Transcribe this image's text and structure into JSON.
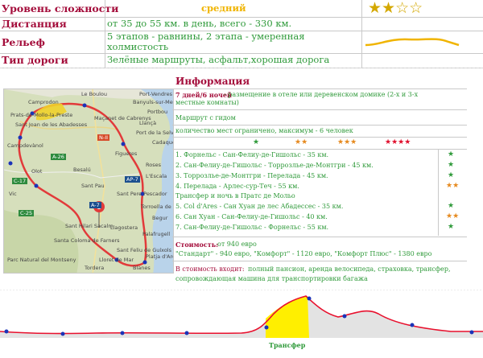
{
  "specs": {
    "difficulty": {
      "label": "Уровень сложности",
      "value": "средний",
      "stars_filled": 2,
      "stars_total": 4
    },
    "distance": {
      "label": "Дистанция",
      "value": "от 35 до 55 км. в день, всего - 330 км."
    },
    "relief": {
      "label": "Рельеф",
      "value_line1": "5 этапов - равнины, 2 этапа - умеренная",
      "value_line2": "холмистость"
    },
    "road": {
      "label": "Тип дороги",
      "value": "Зелёные маршруты, асфальт,хорошая дорога"
    }
  },
  "info": {
    "title": "Информация",
    "nights_bold": "7 дней/6 ночей",
    "nights_rest1": " - размещение в отеле или деревенском домике (2-х и 3-х",
    "nights_rest2": "местные комнаты)",
    "guide": "Маршрут с гидом",
    "limit": "количество мест ограничено, максимум - 6 человек",
    "legend_stars": [
      "★",
      "★★",
      "★★★",
      "★★★★"
    ],
    "stages": [
      {
        "text": "1. Форнельс - Сан-Фелиу-де-Гишольс - 35 км.",
        "stars": "★",
        "color": "green"
      },
      {
        "text": "2. Сан-Фелиу-де-Гишольс - Торрозлье-де-Монтгри - 45 км.",
        "stars": "★",
        "color": "green"
      },
      {
        "text": "3. Торрозлье-де-Монтгри - Перелада - 45 км.",
        "stars": "★",
        "color": "green"
      },
      {
        "text": "4. Перелада - Арлес-сур-Теч - 55 км.",
        "stars": "★★",
        "color": "orange"
      },
      {
        "text": "Трансфер и ночь в Пратс де Мольо",
        "stars": "",
        "color": "none"
      },
      {
        "text": "5. Col d'Ares - Сан Хуан де лес Абадессес - 35 км.",
        "stars": "★",
        "color": "green"
      },
      {
        "text": "6. Сан Хуан - Сан-Фелиу-де-Гишольс - 40 км.",
        "stars": "★★",
        "color": "orange"
      },
      {
        "text": "7. Сан-Фелиу-де-Гишольс - Форнельс - 55 км.",
        "stars": "★",
        "color": "green"
      }
    ],
    "cost_label": "Стоимость:",
    "cost_value": " от 940 евро",
    "tariffs": "\"Стандарт\" - 940 евро, \"Комфорт\" - 1120 евро, \"Комфорт Плюс\" - 1380 евро",
    "included_label": "В стоимость входит:",
    "included_rest1": " полный пансион, аренда велосипеда, страховка, трансфер,",
    "included_rest2": "сопровождающая машина для транспортировки багажа"
  },
  "map": {
    "labels": [
      "Le Boulou",
      "Port-Vendres",
      "Banyuls-sur-Mer",
      "Prats-de-Mollo-la-Preste",
      "Portbou",
      "Maçanet de Cabrenys",
      "Llançà",
      "Campdevànol",
      "Port de la Selva",
      "Cadaqués",
      "Figueres",
      "Olot",
      "Besalú",
      "Roses",
      "L'Escala",
      "Sant Pau",
      "Vic",
      "Torroella de Montgrí",
      "Begur",
      "Palafrugell",
      "Santa Coloma de Farners",
      "Sant Feliu de Guíxols",
      "Parc Natural del Montseny",
      "Lloret de Mar",
      "Tordera",
      "Blanes",
      "Sant Hilari Sacalm",
      "Sant Joan de les Abadesses",
      "Llagostera",
      "Platja d'Aro",
      "Sant Pere Pescador",
      "Camprodon"
    ],
    "road_labels": [
      "A-7",
      "AP-7",
      "C-25",
      "A-26",
      "C-17",
      "N-II"
    ]
  },
  "elevation": {
    "transfer_label": "Трансфер"
  }
}
